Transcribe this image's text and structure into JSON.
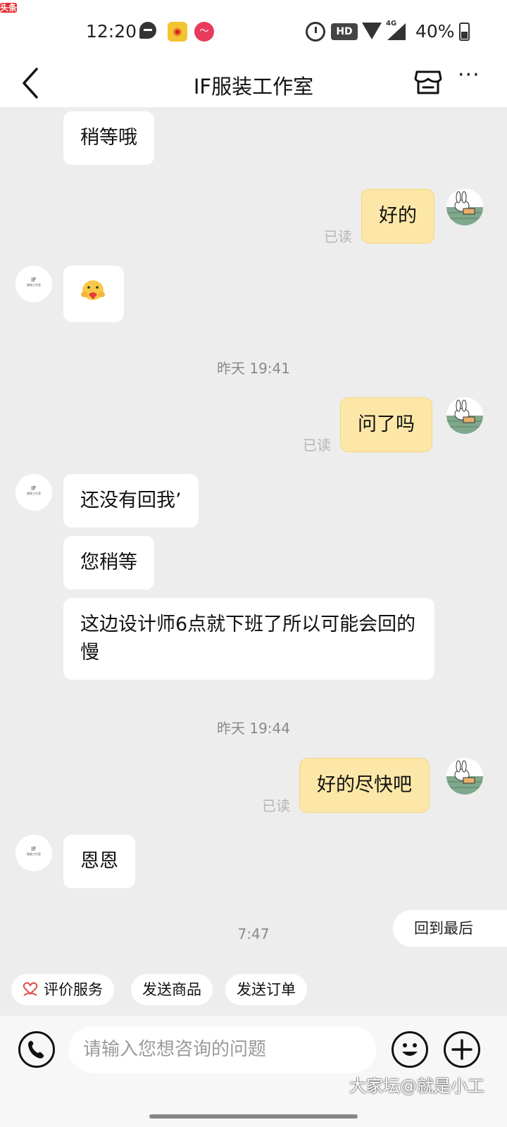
{
  "status_bar": {
    "time": "12:20",
    "hd": "HD",
    "network": "4G",
    "battery": "40%",
    "icons": [
      "message-icon",
      "weibo-icon",
      "app-icon",
      "toutiao-icon",
      "alarm-icon",
      "wifi-icon",
      "signal-icon",
      "battery-icon"
    ],
    "toutiao_label": "头条"
  },
  "header": {
    "title": "IF服装工作室",
    "icons": [
      "back-icon",
      "shop-icon",
      "more-icon"
    ]
  },
  "shop_avatar": {
    "line1": "IF",
    "line2": "服装工作室"
  },
  "messages": [
    {
      "side": "left",
      "text": "稍等哦"
    },
    {
      "side": "right",
      "text": "好的",
      "status": "已读"
    },
    {
      "side": "left",
      "emoji": "hug-emoji"
    },
    {
      "time": "昨天 19:41"
    },
    {
      "side": "right",
      "text": "问了吗",
      "status": "已读"
    },
    {
      "side": "left",
      "text": "还没有回我’"
    },
    {
      "side": "left",
      "text": "您稍等"
    },
    {
      "side": "left",
      "text": "这边设计师6点就下班了所以可能会回的慢"
    },
    {
      "time": "昨天 19:44"
    },
    {
      "side": "right",
      "text": "好的尽快吧",
      "status": "已读"
    },
    {
      "side": "left",
      "text": "恩恩"
    },
    {
      "time": "7:47"
    }
  ],
  "back_to_latest": "回到最后",
  "quick_actions": [
    "评价服务",
    "发送商品",
    "发送订单"
  ],
  "input_bar": {
    "placeholder": "请输入您想咨询的问题",
    "icons": [
      "phone-icon",
      "smile-icon",
      "plus-icon"
    ]
  },
  "watermark": "大家坛@就是小工",
  "colors": {
    "background": "#ededed",
    "my_bubble": "#fde7a8",
    "their_bubble": "#ffffff",
    "read_text": "#b5b5b5"
  }
}
